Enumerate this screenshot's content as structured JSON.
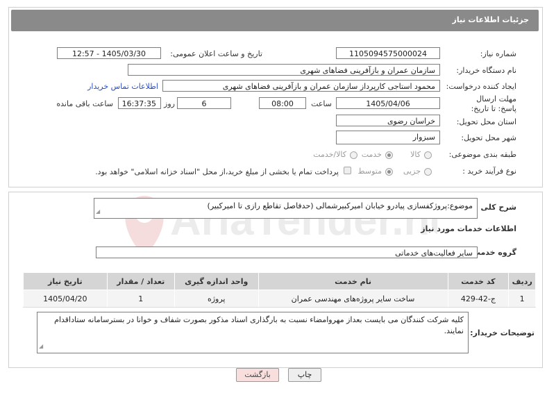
{
  "header": {
    "title": "جزئیات اطلاعات نیاز"
  },
  "form": {
    "need_number_label": "شماره نیاز:",
    "need_number": "1105094575000024",
    "announce_label": "تاریخ و ساعت اعلان عمومی:",
    "announce_value": "1405/03/30 - 12:57",
    "buyer_org_label": "نام دستگاه خریدار:",
    "buyer_org": "سازمان عمران و بازآفرینی فضاهای شهری",
    "requester_label": "ایجاد کننده درخواست:",
    "requester": "محمود استاجی کارپرداز سازمان عمران و بازآفرینی فضاهای شهری",
    "contact_link": "اطلاعات تماس خریدار",
    "deadline_label": "مهلت ارسال پاسخ: تا تاریخ:",
    "deadline_date": "1405/04/06",
    "time_label": "ساعت",
    "deadline_time": "08:00",
    "days_value": "6",
    "days_label": "روز و",
    "remaining_time": "16:37:35",
    "remaining_label": "ساعت باقی مانده",
    "province_label": "استان محل تحویل:",
    "province": "خراسان رضوی",
    "city_label": "شهر محل تحویل:",
    "city": "سبزوار",
    "category_label": "طبقه بندی موضوعی:",
    "category_options": [
      "کالا",
      "خدمت",
      "کالا/خدمت"
    ],
    "process_label": "نوع فرآیند خرید :",
    "process_options": [
      "جزیی",
      "متوسط"
    ],
    "payment_note": "پرداخت تمام یا بخشی از مبلغ خرید،از محل \"اسناد خزانه اسلامی\" خواهد بود."
  },
  "summary": {
    "label": "شرح کلی نیاز:",
    "text": "موضوع:پروژکفسازی پیادرو خیابان امیرکبیرشمالی (حدفاصل تقاطع رازی تا امیرکبیر)"
  },
  "services": {
    "section_title": "اطلاعات خدمات مورد نیاز",
    "group_label": "گروه خدمت:",
    "group_value": "سایر فعالیت‌های خدماتی",
    "columns": [
      "ردیف",
      "کد خدمت",
      "نام خدمت",
      "واحد اندازه گیری",
      "تعداد / مقدار",
      "تاریخ نیاز"
    ],
    "rows": [
      {
        "row": "1",
        "code": "ج-42-429",
        "name": "ساخت سایر پروژه‌های مهندسی عمران",
        "unit": "پروژه",
        "qty": "1",
        "date": "1405/04/20"
      }
    ]
  },
  "buyer_notes": {
    "label": "توضیحات خریدار:",
    "text": "کلیه شرکت کنندگان می بایست بعداز مهروامضاء نسبت به بارگذاری اسناد مذکور بصورت شفاف و خوانا در بسترسامانه ستاداقدام نمایند."
  },
  "buttons": {
    "print": "چاپ",
    "back": "بازگشت"
  },
  "watermark": {
    "text": "AriaTender.neT"
  },
  "colors": {
    "header": "#8a8a8a",
    "link": "#2b4dbf",
    "back_btn": "#f9dede",
    "print_btn": "#eeeeee"
  }
}
